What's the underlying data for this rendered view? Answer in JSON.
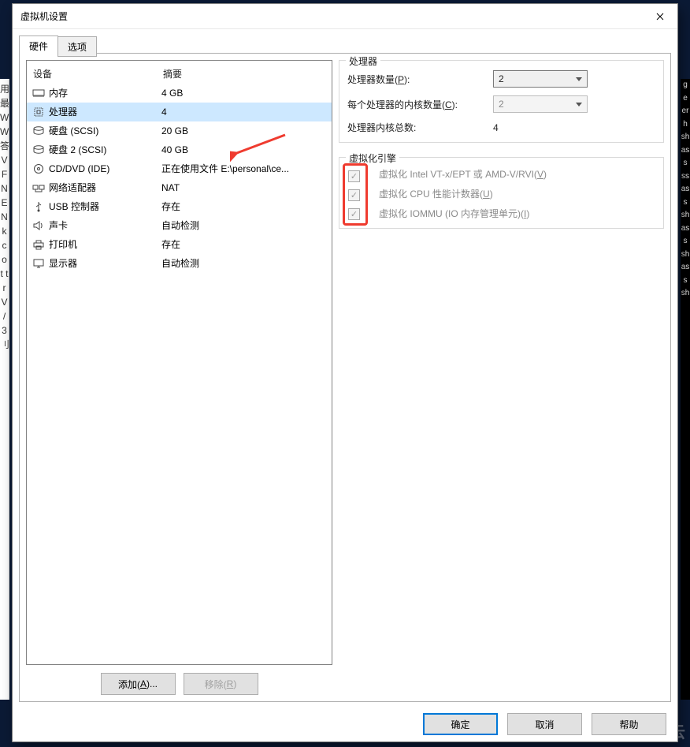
{
  "window": {
    "title": "虚拟机设置"
  },
  "tabs": {
    "hardware": "硬件",
    "options": "选项"
  },
  "columns": {
    "device": "设备",
    "summary": "摘要"
  },
  "devices": [
    {
      "id": "mem",
      "icon": "memory-icon",
      "name": "内存",
      "summary": "4 GB"
    },
    {
      "id": "cpu",
      "icon": "cpu-icon",
      "name": "处理器",
      "summary": "4",
      "selected": true
    },
    {
      "id": "hdd1",
      "icon": "hdd-icon",
      "name": "硬盘 (SCSI)",
      "summary": "20 GB"
    },
    {
      "id": "hdd2",
      "icon": "hdd-icon",
      "name": "硬盘 2 (SCSI)",
      "summary": "40 GB"
    },
    {
      "id": "cd",
      "icon": "cd-icon",
      "name": "CD/DVD (IDE)",
      "summary": "正在使用文件 E:\\personal\\ce..."
    },
    {
      "id": "net",
      "icon": "network-icon",
      "name": "网络适配器",
      "summary": "NAT"
    },
    {
      "id": "usb",
      "icon": "usb-icon",
      "name": "USB 控制器",
      "summary": "存在"
    },
    {
      "id": "snd",
      "icon": "sound-icon",
      "name": "声卡",
      "summary": "自动检测"
    },
    {
      "id": "prn",
      "icon": "printer-icon",
      "name": "打印机",
      "summary": "存在"
    },
    {
      "id": "dsp",
      "icon": "display-icon",
      "name": "显示器",
      "summary": "自动检测"
    }
  ],
  "buttons": {
    "add_pre": "添加(",
    "add_u": "A",
    "add_post": ")...",
    "remove_pre": "移除(",
    "remove_u": "R",
    "remove_post": ")",
    "ok": "确定",
    "cancel": "取消",
    "help": "帮助"
  },
  "cpu_group": {
    "title": "处理器",
    "num_proc_pre": "处理器数量(",
    "num_proc_u": "P",
    "num_proc_post": "):",
    "cores_per_pre": "每个处理器的内核数量(",
    "cores_per_u": "C",
    "cores_per_post": "):",
    "total_label": "处理器内核总数:",
    "num_proc_value": "2",
    "cores_per_value": "2",
    "total_value": "4"
  },
  "virt_group": {
    "title": "虚拟化引擎",
    "vtx_pre": "虚拟化 Intel VT-x/EPT 或 AMD-V/RVI(",
    "vtx_u": "V",
    "vtx_post": ")",
    "perf_pre": "虚拟化 CPU 性能计数器(",
    "perf_u": "U",
    "perf_post": ")",
    "iommu_pre": "虚拟化 IOMMU (IO 内存管理单元)(",
    "iommu_u": "I",
    "iommu_post": ")",
    "vtx_checked": true,
    "perf_checked": true,
    "iommu_checked": true
  },
  "watermark": "亿速云",
  "bg_left_text": "用 最 W W 答 V F N E N k c o t t r V / 3 刂",
  "bg_right_text": "g e er h sh as s ss as s sh as s sh as s sh"
}
